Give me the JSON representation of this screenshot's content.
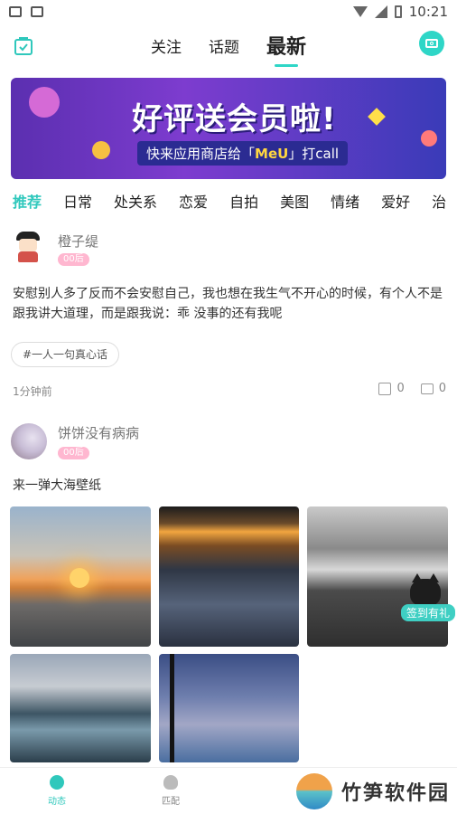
{
  "status_bar": {
    "time": "10:21"
  },
  "header": {
    "tabs": [
      "关注",
      "话题",
      "最新"
    ],
    "active_tab": "最新"
  },
  "banner": {
    "title": "好评送会员啦!",
    "subtitle_prefix": "快来应用商店给「",
    "subtitle_brand": "MeU",
    "subtitle_suffix": "」打call"
  },
  "categories": [
    "推荐",
    "日常",
    "处关系",
    "恋爱",
    "自拍",
    "美图",
    "情绪",
    "爱好",
    "治"
  ],
  "posts": [
    {
      "username": "橙子缇",
      "badge": "00后",
      "text": "安慰别人多了反而不会安慰自己，我也想在我生气不开心的时候，有个人不是跟我讲大道理，而是跟我说：乖 没事的还有我呢",
      "tag": "#一人一句真心话",
      "time": "1分钟前",
      "likes": "0",
      "comments": "0"
    },
    {
      "username": "饼饼没有病病",
      "badge": "00后",
      "text": "来一弹大海壁纸"
    }
  ],
  "floating": {
    "label": "签到有礼"
  },
  "bottom_nav": {
    "items": [
      "动态",
      "匹配"
    ]
  },
  "watermark": {
    "text": "竹笋软件园"
  }
}
